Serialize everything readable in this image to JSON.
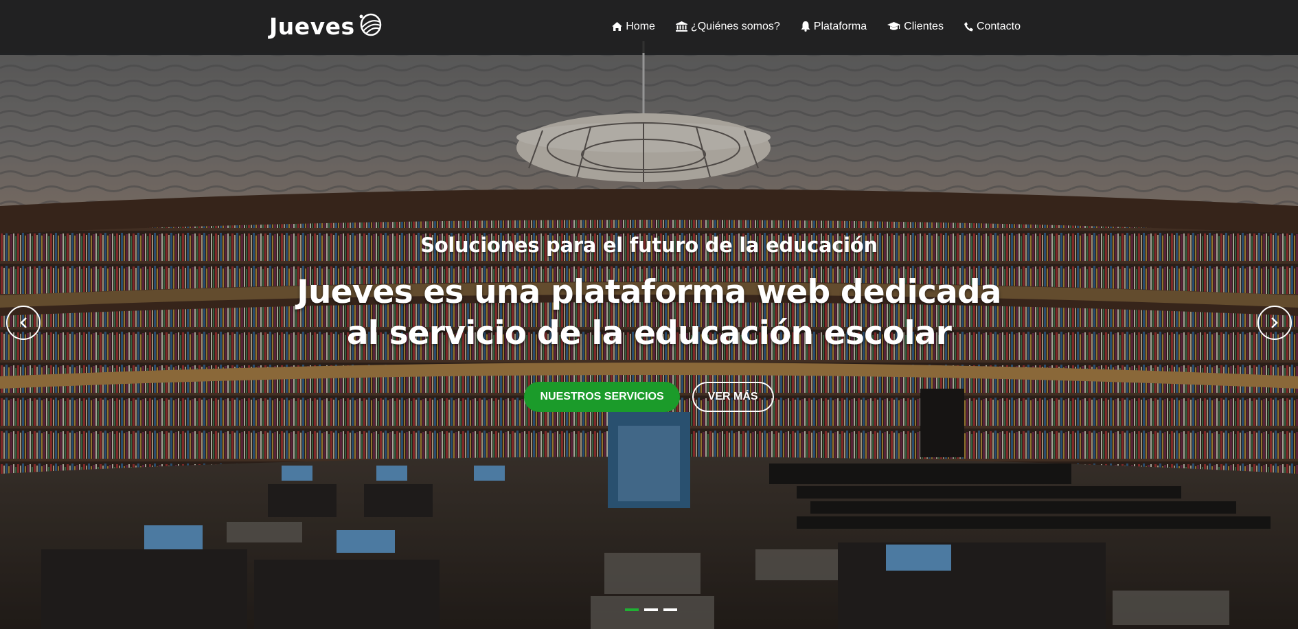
{
  "brand": {
    "name": "Jueves",
    "logo_icon": "swirl-logo-icon"
  },
  "nav": [
    {
      "label": "Home",
      "icon": "home-icon"
    },
    {
      "label": "¿Quiénes somos?",
      "icon": "bank-icon"
    },
    {
      "label": "Plataforma",
      "icon": "bell-icon"
    },
    {
      "label": "Clientes",
      "icon": "graduation-cap-icon"
    },
    {
      "label": "Contacto",
      "icon": "phone-icon"
    }
  ],
  "hero": {
    "subtitle": "Soluciones para el futuro de la educación",
    "title": "Jueves es una plataforma web dedicada al servicio de la educación escolar",
    "primary_button": "NUESTROS SERVICIOS",
    "secondary_button": "VER MÁS",
    "background": "library-photo",
    "slides": 3,
    "active_slide": 1
  },
  "colors": {
    "accent": "#1b9b2a",
    "navbar": "#222222",
    "text": "#ffffff"
  }
}
